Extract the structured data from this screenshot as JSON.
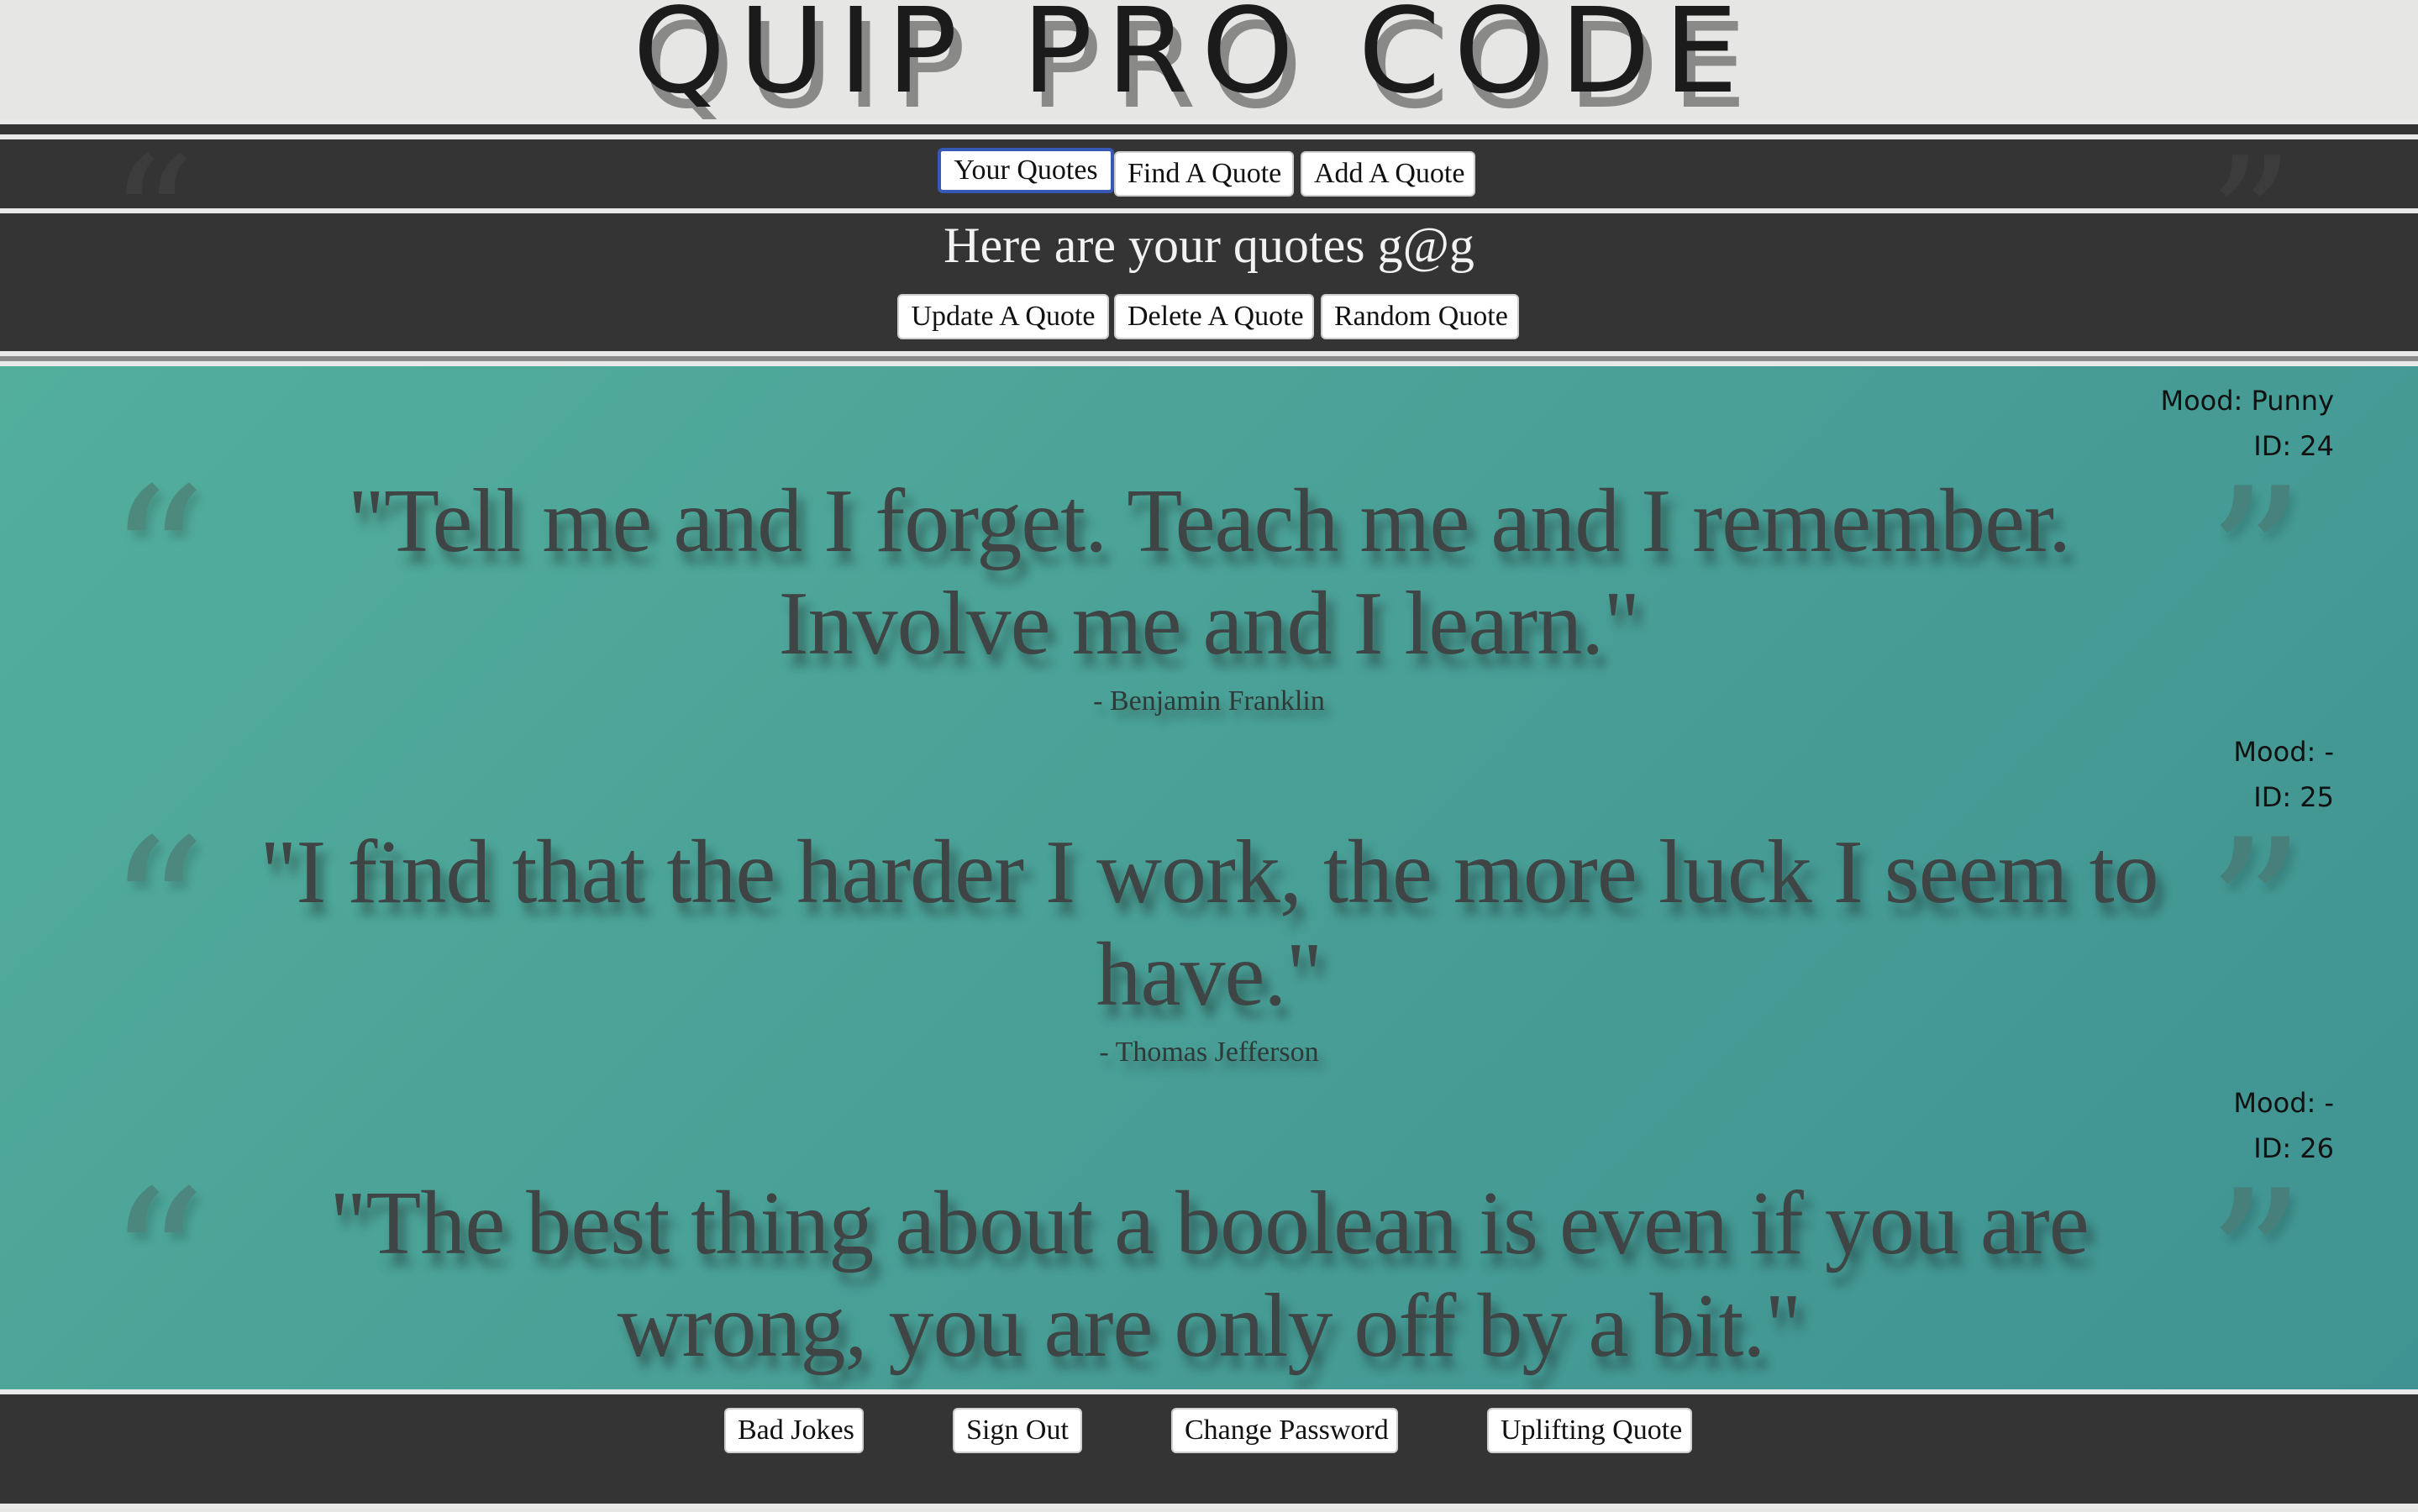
{
  "app": {
    "title": "QUIP PRO CODE"
  },
  "nav": {
    "tabs": [
      {
        "label": "Your Quotes",
        "active": true
      },
      {
        "label": "Find A Quote",
        "active": false
      },
      {
        "label": "Add A Quote",
        "active": false
      }
    ]
  },
  "page": {
    "heading": "Here are your quotes g@g",
    "actions": {
      "update": "Update A Quote",
      "delete": "Delete A Quote",
      "random": "Random Quote"
    }
  },
  "quotes": [
    {
      "mood": "Mood: Punny",
      "id": "ID: 24",
      "text": "\"Tell me and I forget. Teach me and I remember. Involve me and I learn.\"",
      "author": "- Benjamin Franklin"
    },
    {
      "mood": "Mood: -",
      "id": "ID: 25",
      "text": "\"I find that the harder I work, the more luck I seem to have.\"",
      "author": "- Thomas Jefferson"
    },
    {
      "mood": "Mood: -",
      "id": "ID: 26",
      "text": "\"The best thing about a boolean is even if you are wrong, you are only off by a bit.\"",
      "author": ""
    }
  ],
  "icons": {
    "open_quote": "quote-open-icon",
    "close_quote": "quote-close-icon"
  },
  "footer": {
    "bad_jokes": "Bad Jokes",
    "sign_out": "Sign Out",
    "change_password": "Change Password",
    "uplifting": "Uplifting Quote"
  },
  "colors": {
    "band": "#343434",
    "quote_bg_start": "#53ae9c",
    "quote_bg_end": "#3f9392",
    "active_tab_border": "#3559b5"
  }
}
